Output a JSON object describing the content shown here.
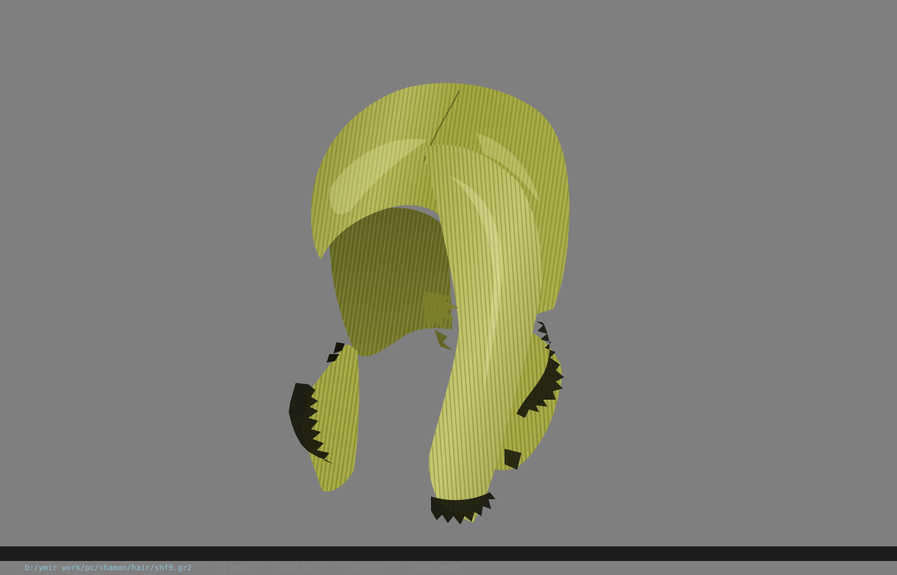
{
  "viewport": {
    "background": "#7f7f7f",
    "model_colors": {
      "hair_base": "#9ea13a",
      "hair_highlight": "#d8d98a",
      "hair_shadow": "#4d4f18",
      "tips": "#111108"
    }
  },
  "status": {
    "file_path": "D:/ymir work/pc/shaman/hair/shf9.gr2",
    "separator": "|",
    "mesh_count": "1 mesh",
    "vertex_count": "5126 vtx",
    "triangle_count": "1734 tri",
    "animation": "nincs anim"
  }
}
